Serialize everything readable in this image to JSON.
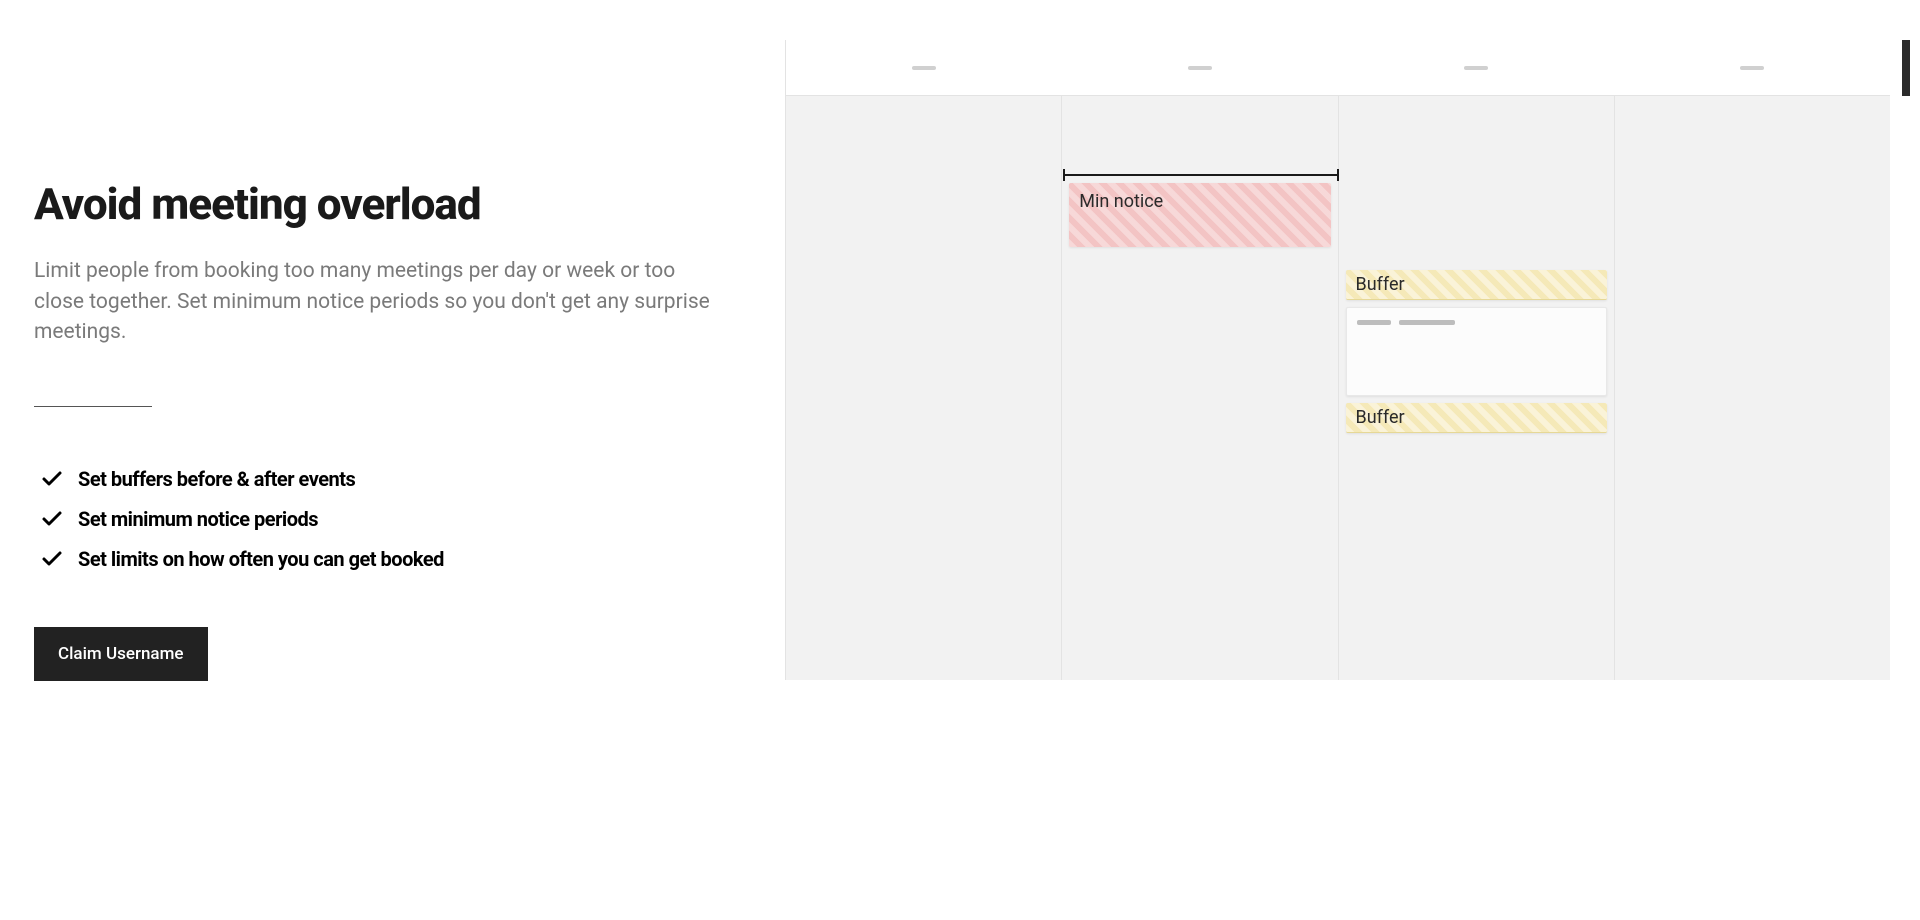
{
  "hero": {
    "heading": "Avoid meeting overload",
    "description": "Limit people from booking too many meetings per day or week or too close together. Set minimum notice periods so you don't get any surprise meetings."
  },
  "features": [
    "Set buffers before & after events",
    "Set minimum notice periods",
    "Set limits on how often you can get booked"
  ],
  "cta": {
    "label": "Claim Username"
  },
  "calendar": {
    "min_notice_label": "Min notice",
    "buffer_label": "Buffer"
  }
}
